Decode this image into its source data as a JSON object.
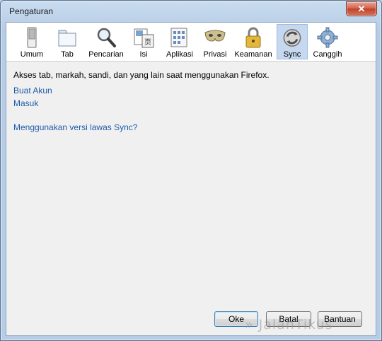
{
  "window": {
    "title": "Pengaturan",
    "close_glyph": "✕"
  },
  "toolbar": {
    "items": [
      {
        "label": "Umum",
        "icon": "switch-icon"
      },
      {
        "label": "Tab",
        "icon": "tab-window-icon"
      },
      {
        "label": "Pencarian",
        "icon": "magnifier-icon"
      },
      {
        "label": "Isi",
        "icon": "content-page-icon"
      },
      {
        "label": "Aplikasi",
        "icon": "applications-icon"
      },
      {
        "label": "Privasi",
        "icon": "mask-icon"
      },
      {
        "label": "Keamanan",
        "icon": "padlock-icon"
      },
      {
        "label": "Sync",
        "icon": "sync-icon",
        "selected": true
      },
      {
        "label": "Canggih",
        "icon": "gear-icon"
      }
    ]
  },
  "sync": {
    "description": "Akses tab, markah, sandi, dan yang lain saat menggunakan Firefox.",
    "create_account_link": "Buat Akun",
    "sign_in_link": "Masuk",
    "legacy_link": "Menggunakan versi lawas Sync?"
  },
  "buttons": {
    "ok": "Oke",
    "cancel": "Batal",
    "help": "Bantuan"
  },
  "watermark": "JalanTikus",
  "colors": {
    "link": "#1d5aa8",
    "selected_tab": "#c5d8ef",
    "close_button": "#c0412b"
  }
}
